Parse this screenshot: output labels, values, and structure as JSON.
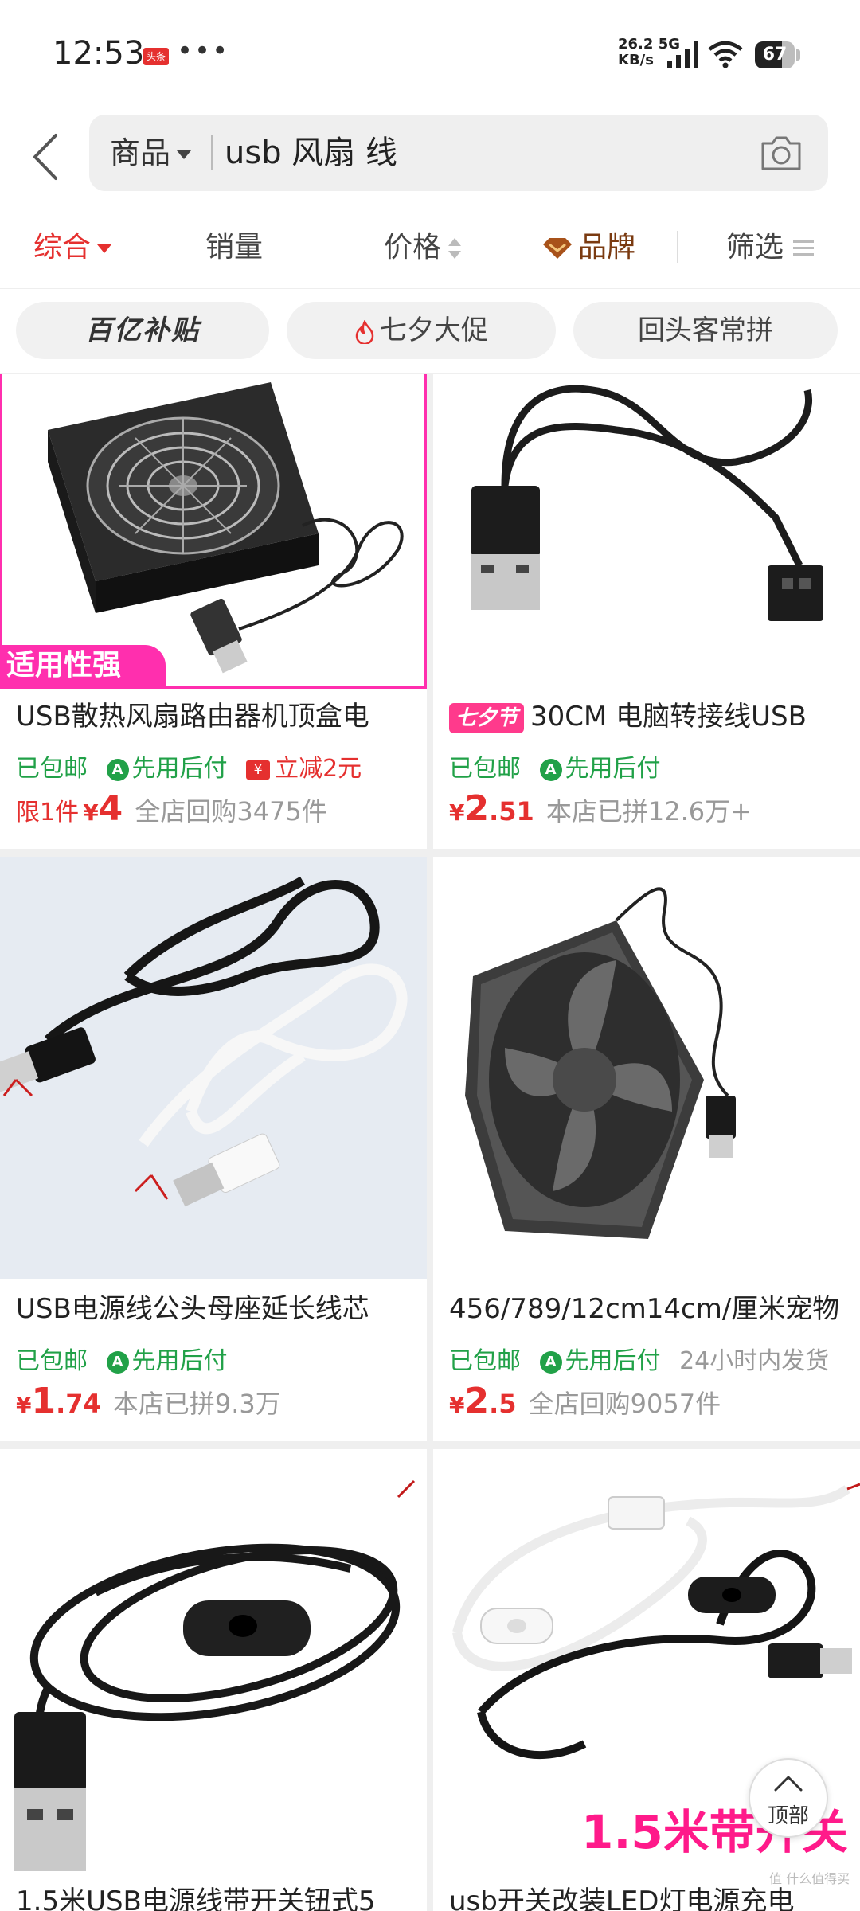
{
  "status_bar": {
    "time": "12:53",
    "badge": "头条",
    "more": "•••",
    "net_speed": "26.2",
    "net_unit": "KB/s",
    "net_type": "5G",
    "battery": "67",
    "battery_level": 0.67
  },
  "search": {
    "scope": "商品",
    "query": "usb 风扇 线"
  },
  "sort_bar": {
    "comprehensive": "综合",
    "sales": "销量",
    "price": "价格",
    "brand": "品牌",
    "filter": "筛选"
  },
  "chips": [
    "百亿补贴",
    "七夕大促",
    "回头客常拼"
  ],
  "products": [
    {
      "title": "USB散热风扇路由器机顶盒电",
      "image_badge": "适用性强",
      "tags": {
        "free": "已包邮",
        "pay_later": "先用后付",
        "discount": "立减2元"
      },
      "limit": "限1件",
      "price_currency": "¥",
      "price_int": "4",
      "price_dec": "",
      "sales": "全店回购3475件"
    },
    {
      "title": "30CM 电脑转接线USB",
      "title_badge": "七夕节",
      "tags": {
        "free": "已包邮",
        "pay_later": "先用后付"
      },
      "price_currency": "¥",
      "price_int": "2",
      "price_dec": ".51",
      "sales": "本店已拼12.6万+"
    },
    {
      "title": "USB电源线公头母座延长线芯",
      "tags": {
        "free": "已包邮",
        "pay_later": "先用后付"
      },
      "price_currency": "¥",
      "price_int": "1",
      "price_dec": ".74",
      "sales": "本店已拼9.3万"
    },
    {
      "title": "456/789/12cm14cm/厘米宠物",
      "tags": {
        "free": "已包邮",
        "pay_later": "先用后付",
        "ship": "24小时内发货"
      },
      "price_currency": "¥",
      "price_int": "2",
      "price_dec": ".5",
      "sales": "全店回购9057件"
    },
    {
      "title": "1.5米USB电源线带开关钮式5",
      "image_badge": ""
    },
    {
      "title": "usb开关改装LED灯电源充电",
      "image_badge": "1.5米带开关"
    }
  ],
  "to_top": "顶部",
  "watermark": "值 什么值得买",
  "colors": {
    "accent": "#e5302f",
    "green": "#21a148",
    "magenta": "#ff2fae"
  }
}
